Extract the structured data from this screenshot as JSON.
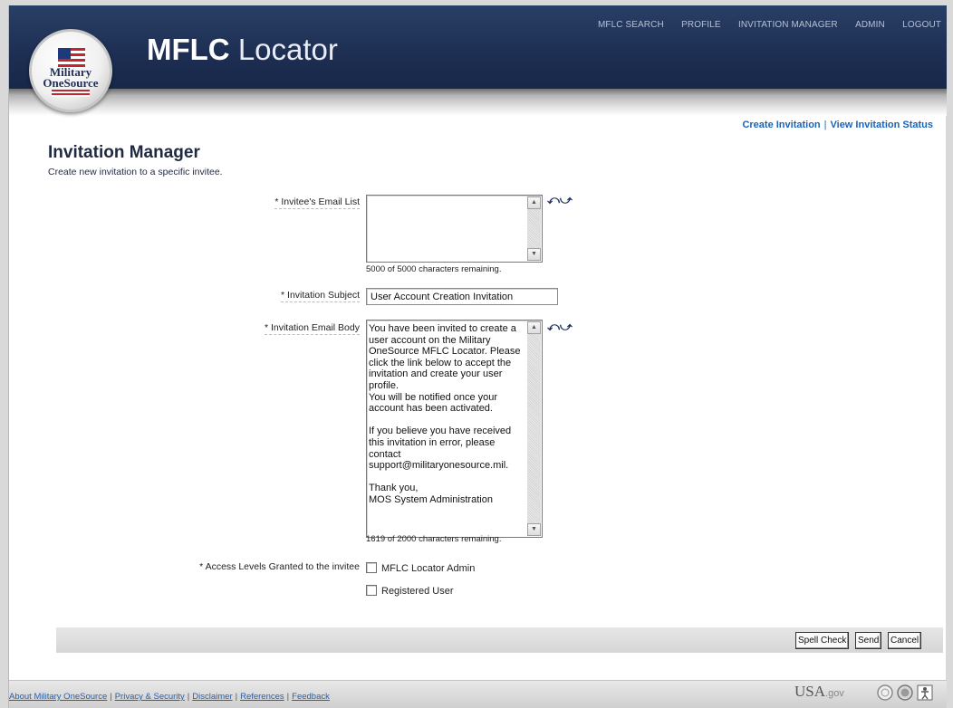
{
  "header": {
    "logo_text_line1": "Military",
    "logo_text_line2": "OneSource",
    "title_bold": "MFLC",
    "title_light": "Locator",
    "nav": [
      "MFLC SEARCH",
      "PROFILE",
      "INVITATION MANAGER",
      "ADMIN",
      "LOGOUT"
    ]
  },
  "sublinks": {
    "create": "Create Invitation",
    "separator": "|",
    "view_status": "View Invitation Status"
  },
  "page": {
    "title": "Invitation Manager",
    "description": "Create new invitation to a specific invitee."
  },
  "form": {
    "email_list": {
      "label": "* Invitee's Email List",
      "value": "",
      "counter": "5000 of 5000 characters remaining."
    },
    "subject": {
      "label": "* Invitation Subject",
      "value": "User Account Creation Invitation"
    },
    "body": {
      "label": "* Invitation Email Body",
      "value": "You have been invited to create a user account on the Military OneSource MFLC Locator. Please click the link below to accept the invitation and create your user profile.\nYou will be notified once your account has been activated.\n\nIf you believe you have received this invitation in error, please contact support@militaryonesource.mil.\n\nThank you,\nMOS System Administration",
      "counter": "1619 of 2000 characters remaining."
    },
    "access": {
      "label": "* Access Levels Granted to the invitee",
      "options": [
        {
          "label": "MFLC Locator Admin",
          "checked": false
        },
        {
          "label": "Registered User",
          "checked": false
        }
      ]
    }
  },
  "actions": {
    "spell_check": "Spell Check",
    "send": "Send",
    "cancel": "Cancel"
  },
  "footer": {
    "links": [
      "About Military OneSource",
      "Privacy & Security",
      "Disclaimer",
      "References",
      "Feedback"
    ],
    "separator": "|",
    "usagov": "USA",
    "usagov_suffix": ".gov"
  },
  "colors": {
    "header_bg": "#1d2e52",
    "link_blue": "#1c63b7",
    "title_navy": "#1f2940",
    "flag_red": "#c1272d"
  }
}
